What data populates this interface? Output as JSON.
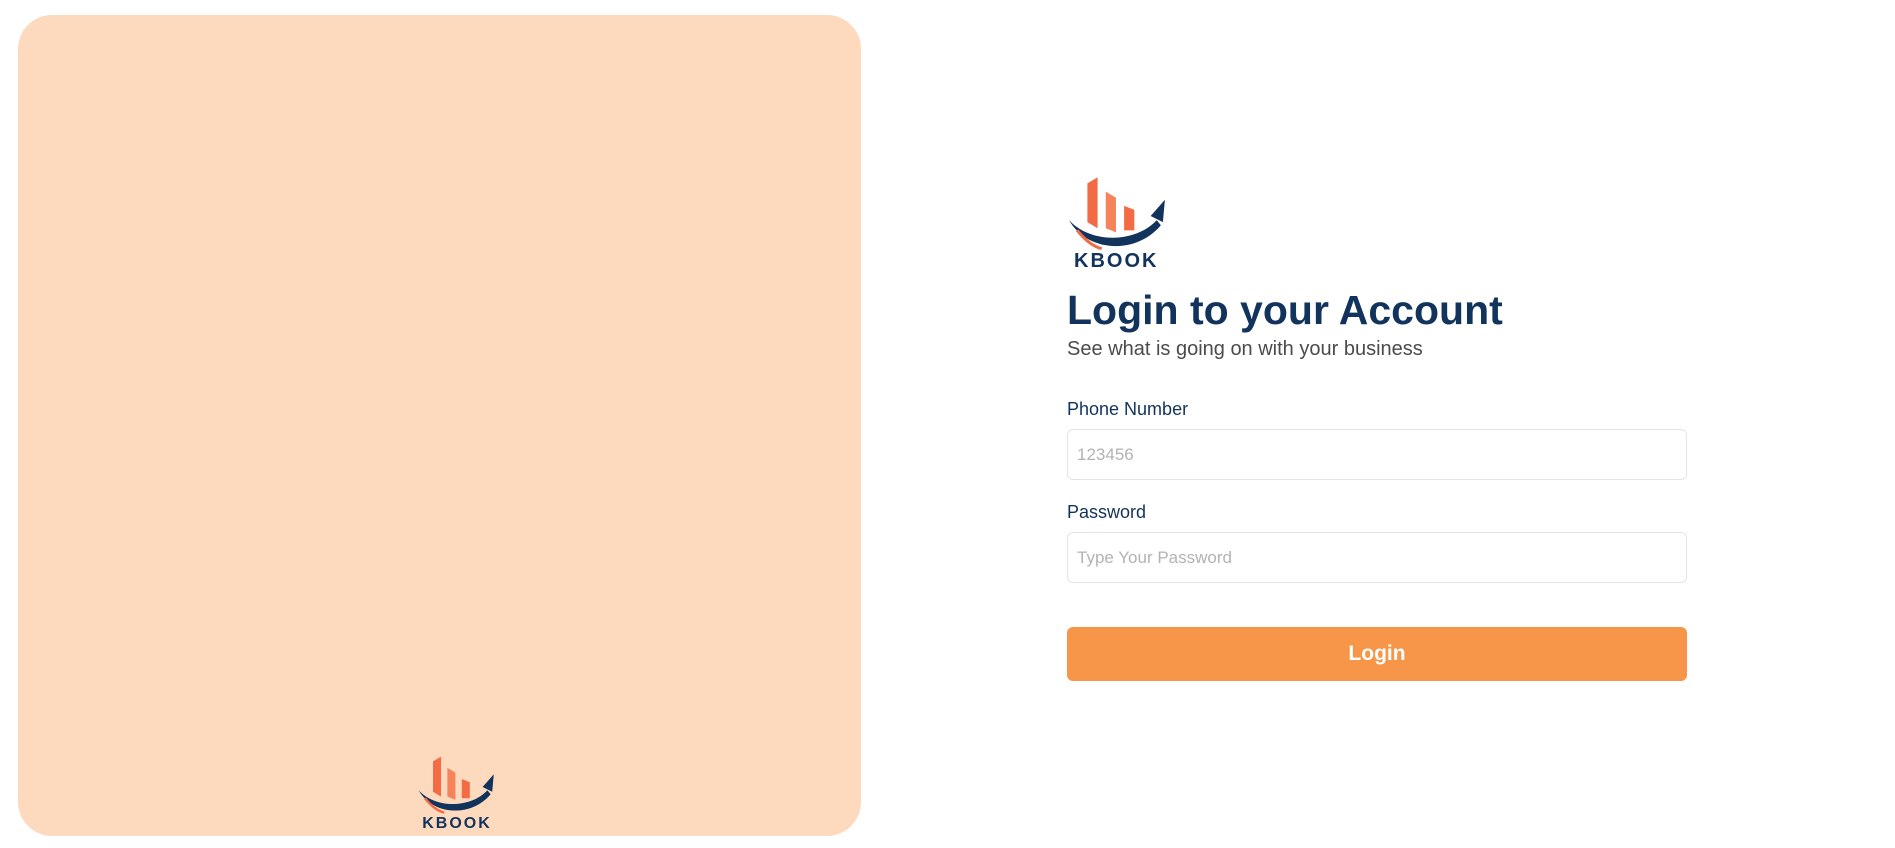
{
  "brand": {
    "name": "KBOOK",
    "colors": {
      "navy": "#12335c",
      "orange": "#f26b45",
      "orange_light": "#f5845a",
      "panel_peach": "#fdd9bd",
      "button_orange": "#f79648"
    }
  },
  "illustration_panel": {
    "logo_text": "KBOOK"
  },
  "form": {
    "title": "Login to your Account",
    "subtitle": "See what is going on with your business",
    "phone": {
      "label": "Phone Number",
      "placeholder": "123456",
      "value": ""
    },
    "password": {
      "label": "Password",
      "placeholder": "Type Your Password",
      "value": ""
    },
    "submit_label": "Login"
  }
}
